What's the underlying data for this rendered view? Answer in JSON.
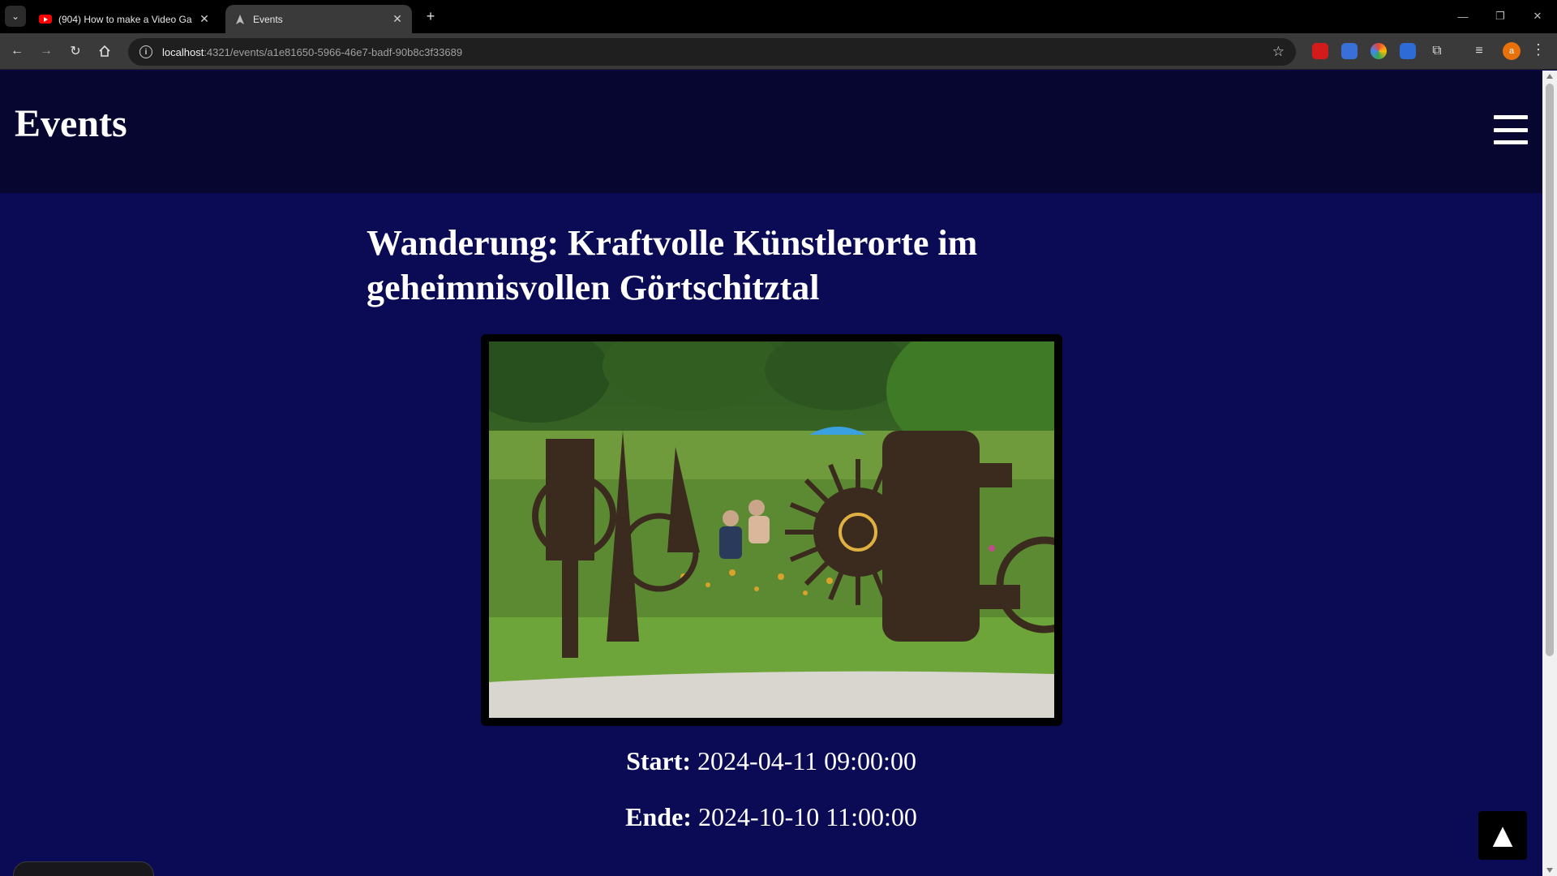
{
  "browser": {
    "tabs": [
      {
        "title": "(904) How to make a Video Ga",
        "favicon": "youtube-icon",
        "active": false
      },
      {
        "title": "Events",
        "favicon": "page-icon",
        "active": true
      }
    ],
    "url": {
      "host": "localhost",
      "path": ":4321/events/a1e81650-5966-46e7-badf-90b8c3f33689"
    },
    "profile_initial": "a"
  },
  "site": {
    "title": "Events"
  },
  "event": {
    "title": "Wanderung: Kraftvolle Künstlerorte im geheimnisvollen Görtschitztal",
    "start_label": "Start:",
    "start_value": "2024-04-11 09:00:00",
    "end_label": "Ende:",
    "end_value": "2024-10-10 11:00:00"
  },
  "scroll_top_glyph": "▲",
  "colors": {
    "page_bg": "#0a0a55",
    "header_bg": "#060631",
    "text": "#ffffff"
  }
}
